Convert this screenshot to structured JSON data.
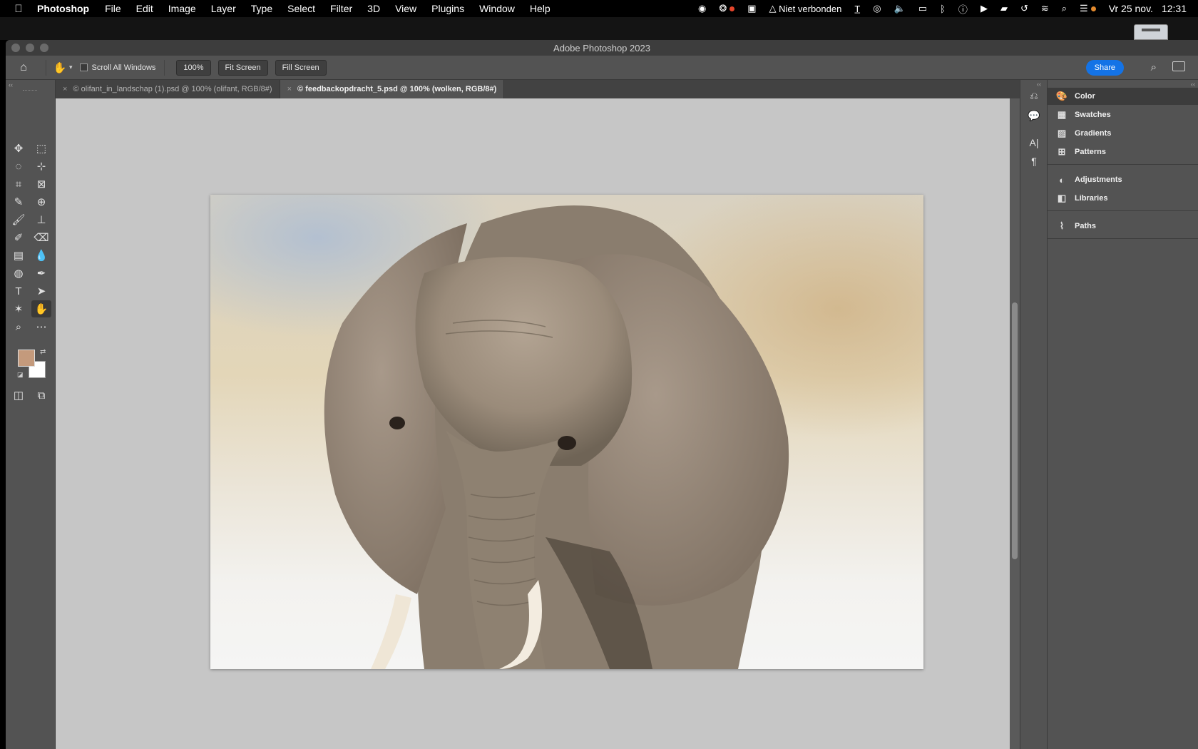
{
  "menubar": {
    "app_name": "Photoshop",
    "menus": [
      "File",
      "Edit",
      "Image",
      "Layer",
      "Type",
      "Select",
      "Filter",
      "3D",
      "View",
      "Plugins",
      "Window",
      "Help"
    ],
    "network_status": "Niet verbonden",
    "date": "Vr 25 nov.",
    "time": "12:31"
  },
  "window": {
    "title": "Adobe Photoshop 2023"
  },
  "options_bar": {
    "scroll_all_windows_label": "Scroll All Windows",
    "zoom_value": "100%",
    "fit_screen_label": "Fit Screen",
    "fill_screen_label": "Fill Screen",
    "share_label": "Share"
  },
  "tabs": [
    {
      "title": "© olifant_in_landschap (1).psd @ 100% (olifant, RGB/8#)",
      "active": false
    },
    {
      "title": "© feedbackopdracht_5.psd @ 100% (wolken, RGB/8#)",
      "active": true
    }
  ],
  "tools": {
    "foreground_color": "#c49a7c",
    "background_color": "#ffffff"
  },
  "panels": {
    "group1": [
      "Color",
      "Swatches",
      "Gradients",
      "Patterns"
    ],
    "group2": [
      "Adjustments",
      "Libraries"
    ],
    "group3": [
      "Paths"
    ]
  },
  "colors": {
    "share_button": "#1473e6",
    "canvas_background": "#c6c6c6",
    "ui_panel": "#535353"
  }
}
